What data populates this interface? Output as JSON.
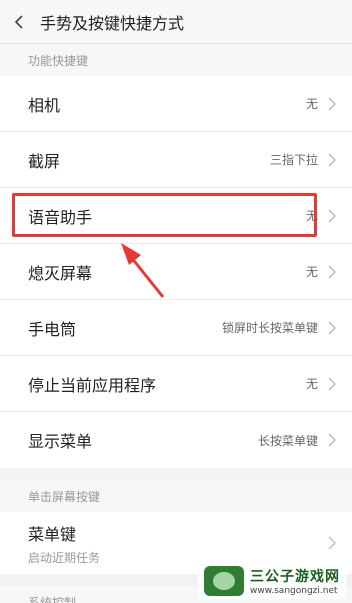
{
  "header": {
    "title": "手势及按键快捷方式"
  },
  "sections": {
    "shortcuts": {
      "label": "功能快捷键",
      "rows": [
        {
          "label": "相机",
          "value": "无"
        },
        {
          "label": "截屏",
          "value": "三指下拉"
        },
        {
          "label": "语音助手",
          "value": "无"
        },
        {
          "label": "熄灭屏幕",
          "value": "无"
        },
        {
          "label": "手电筒",
          "value": "锁屏时长按菜单键"
        },
        {
          "label": "停止当前应用程序",
          "value": "无"
        },
        {
          "label": "显示菜单",
          "value": "长按菜单键"
        }
      ]
    },
    "single_tap": {
      "label": "单击屏幕按键",
      "rows": [
        {
          "label": "菜单键",
          "sub": "启动近期任务"
        }
      ]
    },
    "system": {
      "label": "系统控制"
    }
  },
  "watermark": {
    "name": "三公子游戏网",
    "url": "www.sangongzi.net"
  },
  "colors": {
    "highlight": "#e53935"
  }
}
